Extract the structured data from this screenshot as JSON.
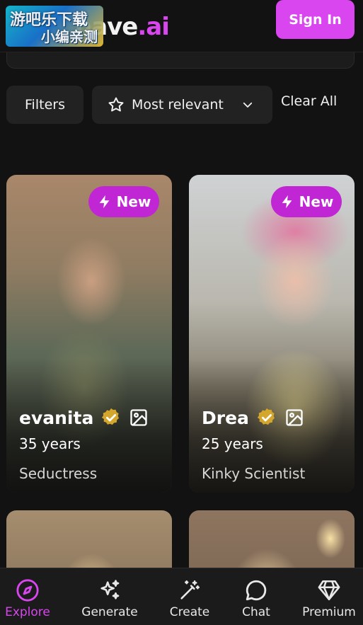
{
  "header": {
    "logo_text_main": "have",
    "logo_text_accent": ".ai",
    "watermark_line1": "游吧乐下载",
    "watermark_line2": "小编亲测",
    "signin_label": "Sign In"
  },
  "filters": {
    "filters_label": "Filters",
    "sort_label": "Most relevant",
    "clear_label": "Clear All"
  },
  "cards": [
    {
      "badge": "New",
      "name": "evanita",
      "age": "35 years",
      "tag": "Seductress"
    },
    {
      "badge": "New",
      "name": "Drea",
      "age": "25 years",
      "tag": "Kinky Scientist"
    }
  ],
  "nav": {
    "items": [
      {
        "label": "Explore",
        "icon": "compass-icon"
      },
      {
        "label": "Generate",
        "icon": "sparkles-icon"
      },
      {
        "label": "Create",
        "icon": "magic-wand-icon"
      },
      {
        "label": "Chat",
        "icon": "chat-bubble-icon"
      },
      {
        "label": "Premium",
        "icon": "diamond-icon"
      }
    ]
  },
  "colors": {
    "accent": "#d946ef",
    "badge": "#c026d3",
    "background": "#121212",
    "verified": "#d4a72c"
  }
}
